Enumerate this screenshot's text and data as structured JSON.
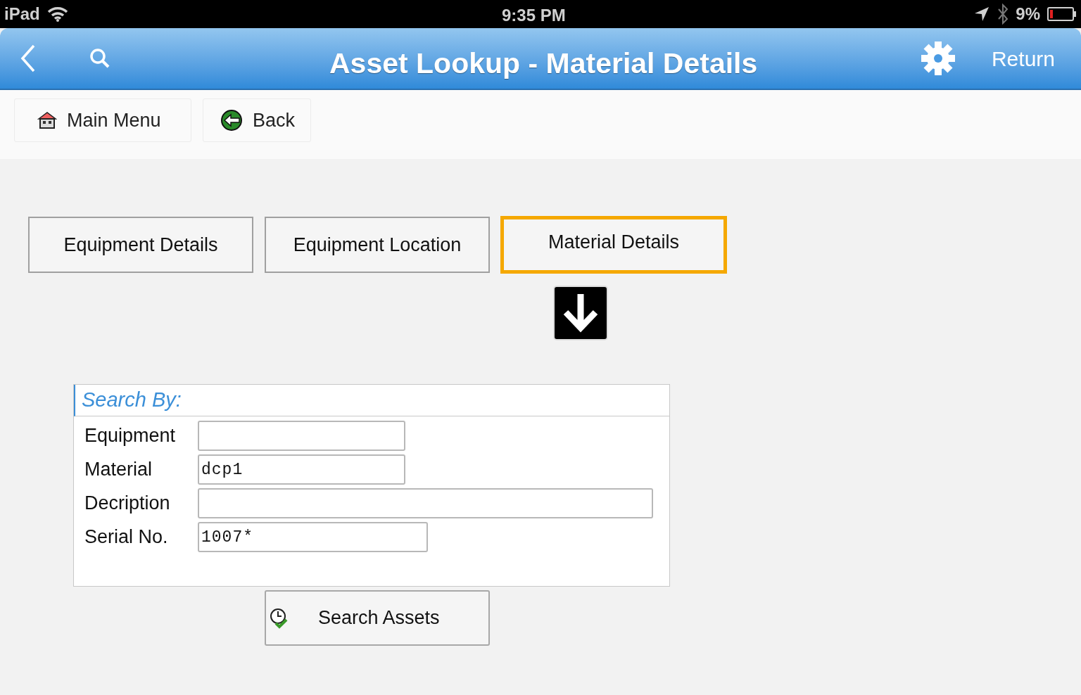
{
  "status_bar": {
    "carrier": "iPad",
    "time": "9:35 PM",
    "battery": "9%"
  },
  "nav_bar": {
    "title": "Asset Lookup - Material Details",
    "return_label": "Return"
  },
  "toolbar": [
    {
      "label": "Main Menu",
      "kind": "home"
    },
    {
      "label": "Back",
      "kind": "back"
    }
  ],
  "tabs": [
    {
      "label": "Equipment Details",
      "selected": false
    },
    {
      "label": "Equipment Location",
      "selected": false
    },
    {
      "label": "Material Details",
      "selected": true
    }
  ],
  "search_panel": {
    "title": "Search By:",
    "fields": [
      {
        "label": "Equipment"
      },
      {
        "label": "Material",
        "value": "dcp1"
      },
      {
        "label": "Decription"
      },
      {
        "label": "Serial No.",
        "value": "1007*"
      }
    ]
  },
  "search_button": {
    "label": "Search Assets"
  }
}
